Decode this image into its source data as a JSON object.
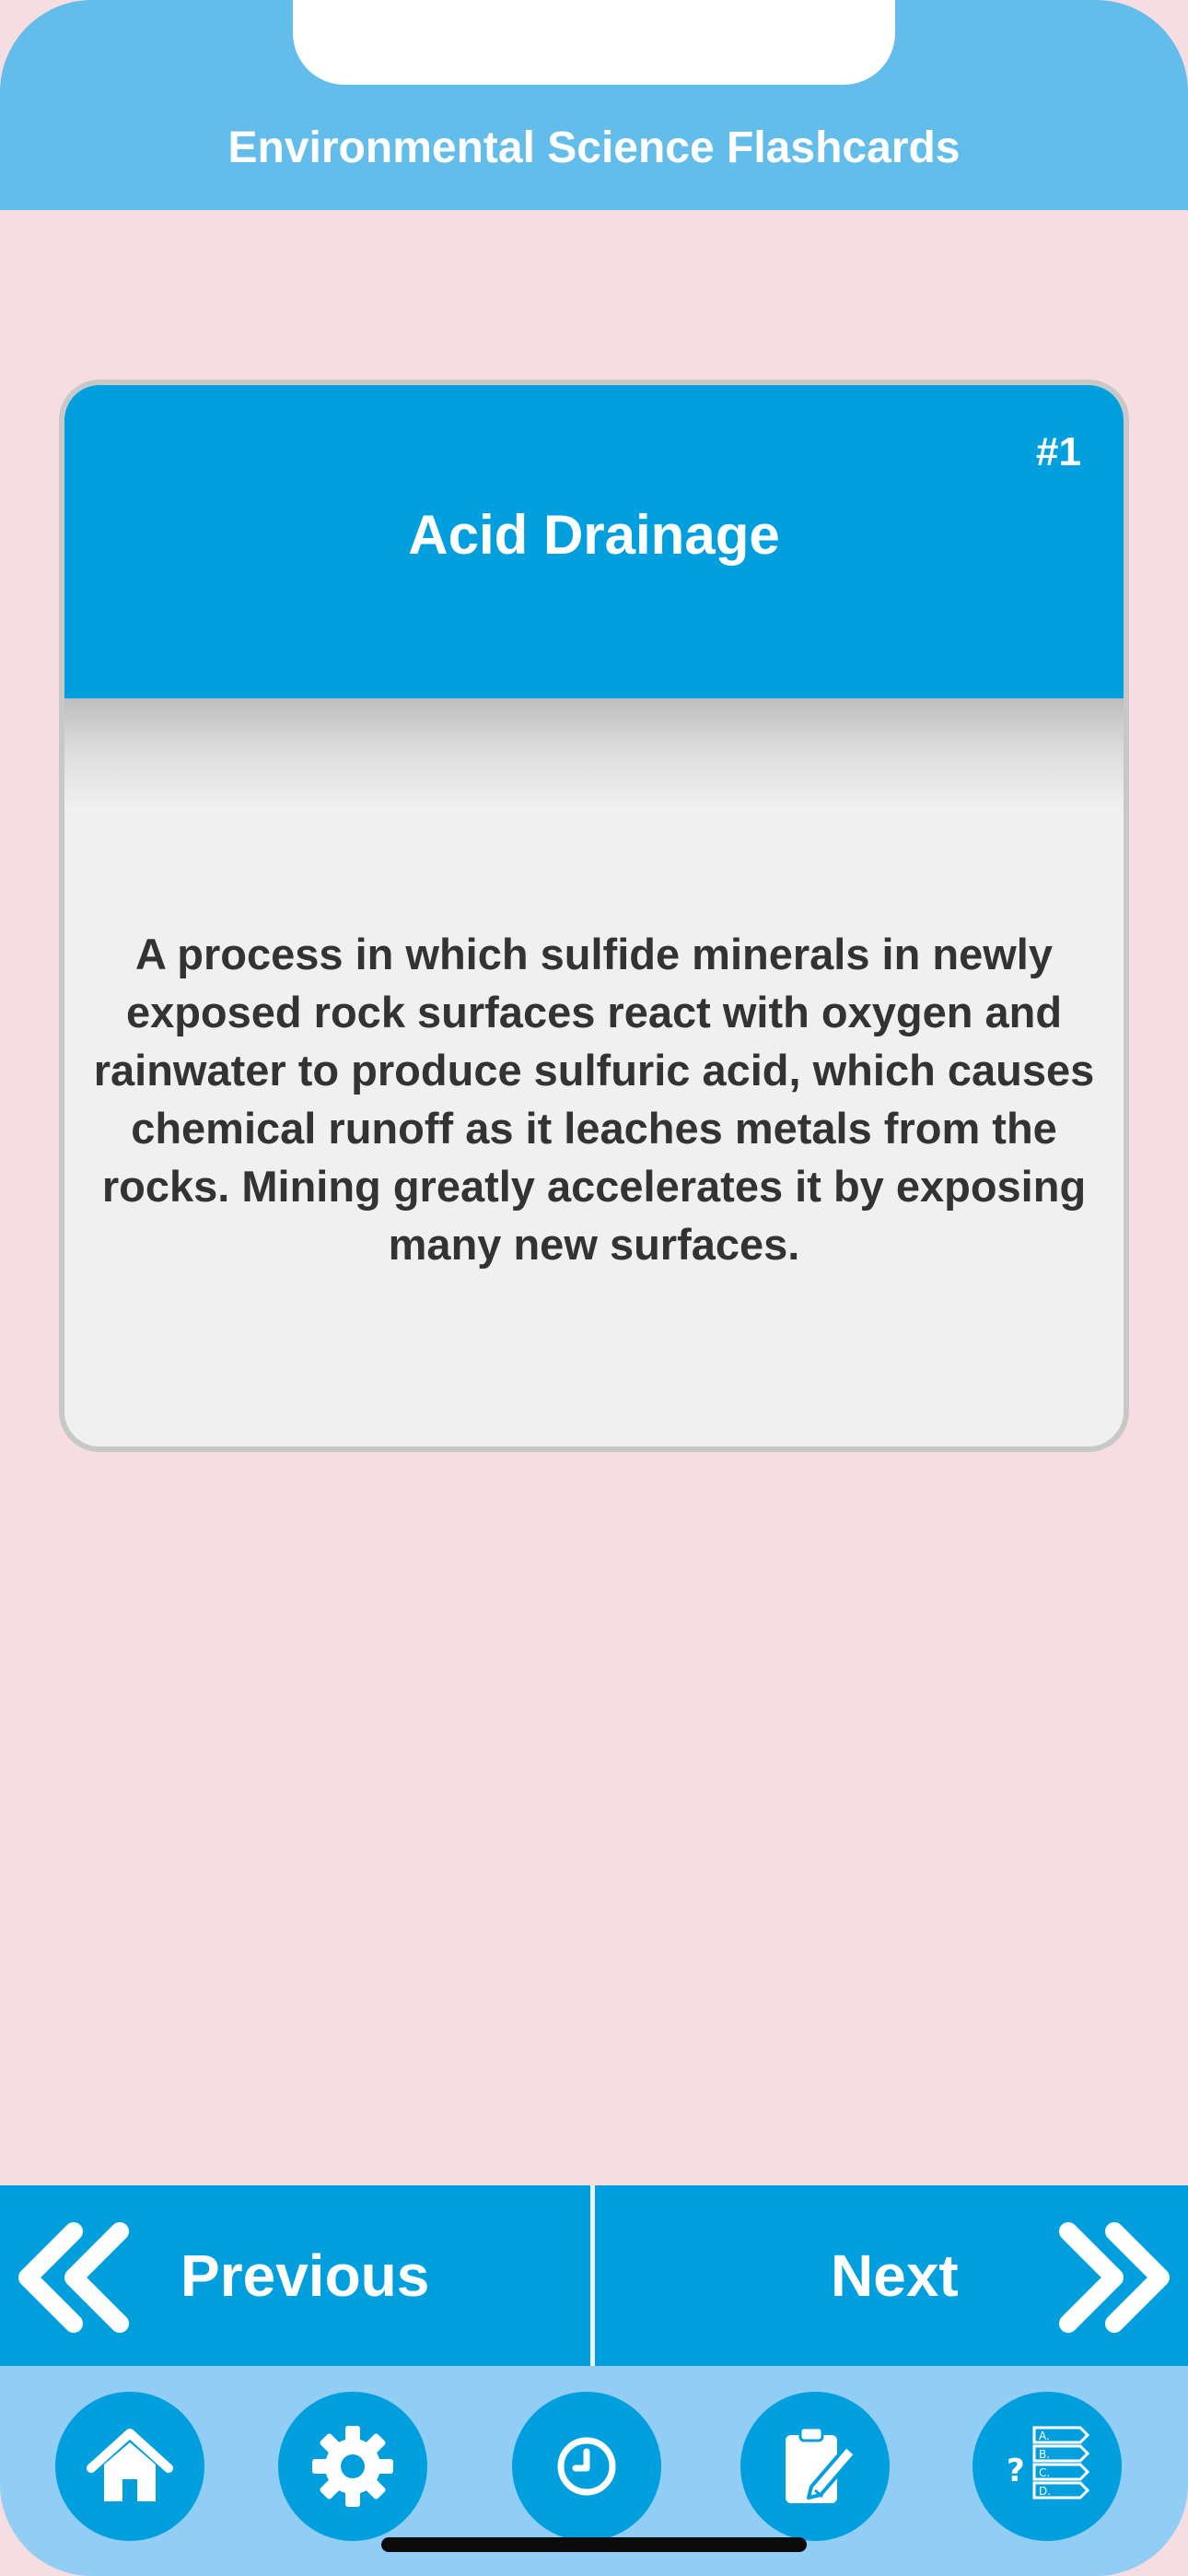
{
  "header": {
    "title": "Environmental Science Flashcards"
  },
  "card": {
    "number": "#1",
    "term": "Acid Drainage",
    "definition": "A process in which sulfide minerals in newly exposed rock surfaces react with oxygen and rainwater to produce sulfuric acid, which causes chemical runoff as it leaches metals from the rocks. Mining greatly accelerates it by exposing many new surfaces."
  },
  "nav": {
    "previous_label": "Previous",
    "next_label": "Next"
  },
  "tabbar": {
    "items": [
      {
        "icon": "home-icon"
      },
      {
        "icon": "gear-icon"
      },
      {
        "icon": "clock-icon"
      },
      {
        "icon": "notes-icon"
      },
      {
        "icon": "quiz-icon"
      }
    ]
  },
  "colors": {
    "header": "#62bdea",
    "accent": "#019fde",
    "background": "#f5dde1",
    "tabbar": "#91cdf4"
  }
}
